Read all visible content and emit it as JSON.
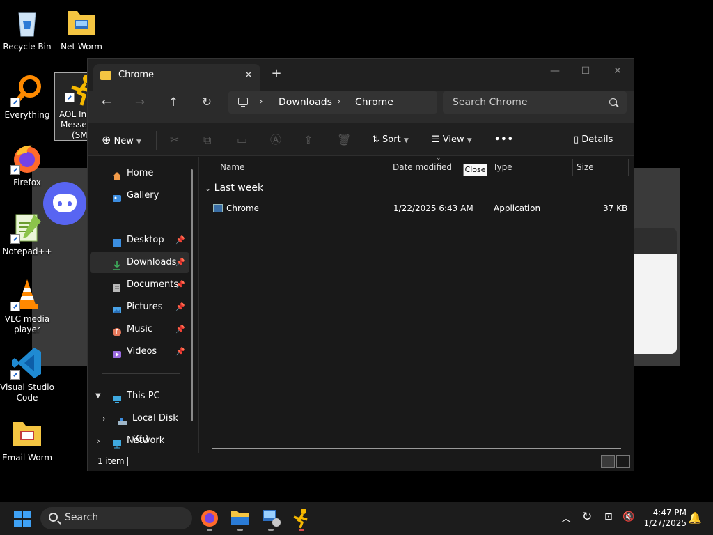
{
  "desktop": {
    "icons": [
      {
        "label": "Recycle Bin"
      },
      {
        "label": "Net-Worm"
      },
      {
        "label": "Everything"
      },
      {
        "label": "AOL Instant Messenger (SM)",
        "label_line1": "AOL In",
        "label_line2": "Messen",
        "label_line3": "(SM"
      },
      {
        "label": "Firefox"
      },
      {
        "label": "Notepad++"
      },
      {
        "label": "VLC media player",
        "label_line1": "VLC media",
        "label_line2": "player"
      },
      {
        "label": "Visual Studio Code",
        "label_line1": "Visual Studio",
        "label_line2": "Code"
      },
      {
        "label": "Email-Worm"
      }
    ]
  },
  "window": {
    "tab_title": "Chrome",
    "tab_close": "✕",
    "new_tab": "+",
    "controls": {
      "minimize": "—",
      "maximize": "☐",
      "close": "✕"
    },
    "nav": {
      "back": "←",
      "forward": "→",
      "up": "↑",
      "refresh": "↻"
    },
    "breadcrumb": [
      "Downloads",
      "Chrome"
    ],
    "breadcrumb_sep": "›",
    "search_placeholder": "Search Chrome",
    "toolbar": {
      "new_label": "New",
      "sort_label": "Sort",
      "view_label": "View",
      "more_label": "•••",
      "details_label": "Details"
    },
    "sidebar": {
      "home": "Home",
      "gallery": "Gallery",
      "quick_access": [
        {
          "label": "Desktop",
          "icon": "desktop-icon",
          "color": "#3b8ee0"
        },
        {
          "label": "Downloads",
          "icon": "download-icon",
          "color": "#3fb05d"
        },
        {
          "label": "Documents",
          "icon": "document-icon",
          "color": "#b9b9b9"
        },
        {
          "label": "Pictures",
          "icon": "picture-icon",
          "color": "#4aa3e8"
        },
        {
          "label": "Music",
          "icon": "music-icon",
          "color": "#e5785a"
        },
        {
          "label": "Videos",
          "icon": "video-icon",
          "color": "#9a6ae0"
        }
      ],
      "pin": "📌",
      "this_pc": "This PC",
      "local_disk": "Local Disk (C:)",
      "network": "Network"
    },
    "columns": [
      "Name",
      "Date modified",
      "Type",
      "Size"
    ],
    "group": "Last week",
    "files": [
      {
        "name": "Chrome",
        "date": "1/22/2025 6:43 AM",
        "type": "Application",
        "size": "37 KB"
      }
    ],
    "status": "1 item",
    "tooltip": "Close"
  },
  "taskbar": {
    "search_label": "Search",
    "time": "4:47 PM",
    "date": "1/27/2025"
  }
}
